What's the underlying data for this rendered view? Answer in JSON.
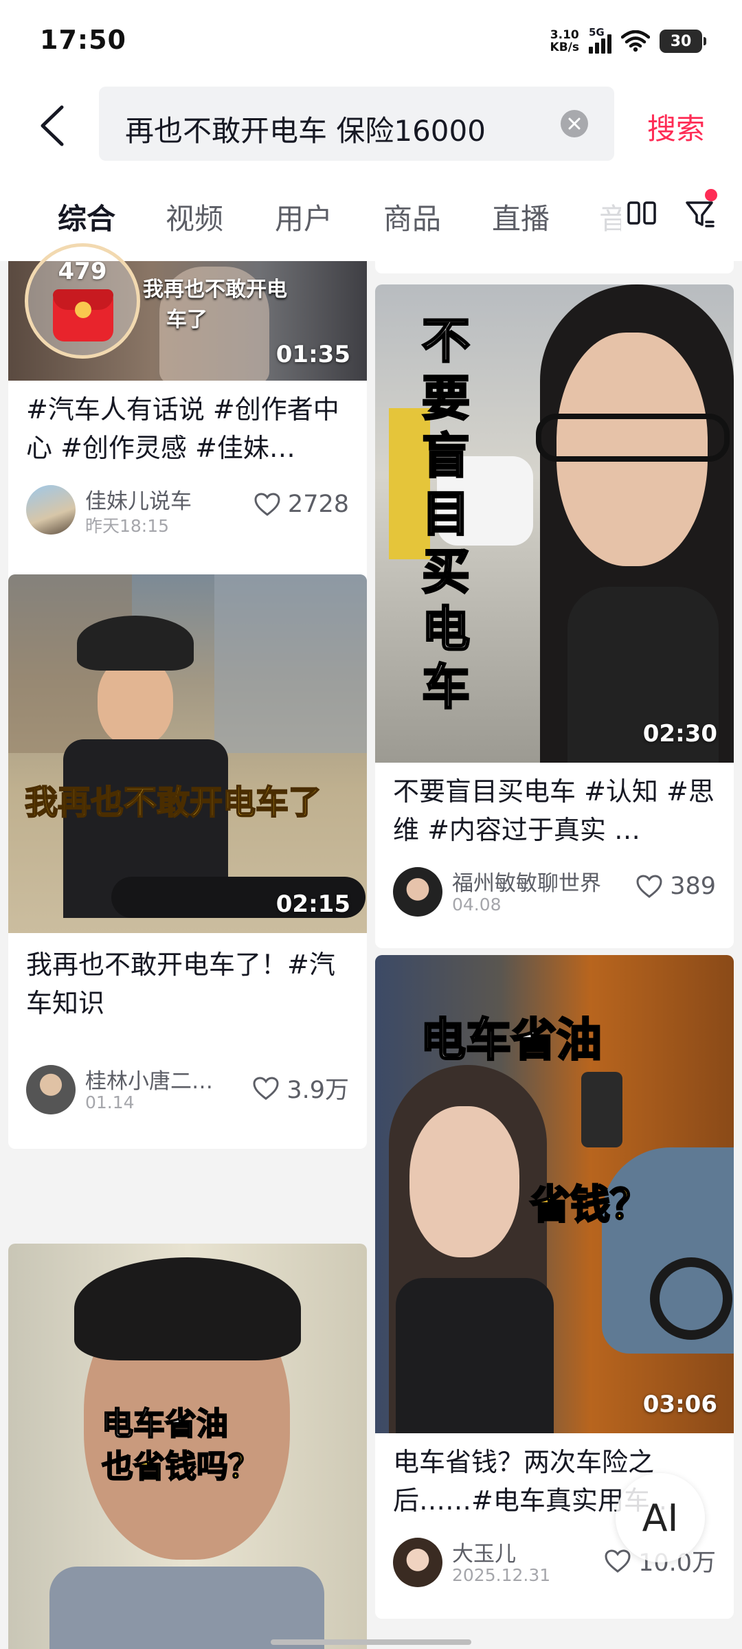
{
  "status_bar": {
    "time": "17:50",
    "net_speed_value": "3.10",
    "net_speed_unit": "KB/s",
    "network_type": "5G",
    "battery": "30"
  },
  "search": {
    "query": "再也不敢开电车 保险16000",
    "button_label": "搜索"
  },
  "tabs": [
    "综合",
    "视频",
    "用户",
    "商品",
    "直播",
    "音"
  ],
  "active_tab": "综合",
  "red_packet": {
    "count": "479"
  },
  "left_column": [
    {
      "overlay_line1": "我再也不敢开电",
      "overlay_line2": "车了",
      "duration": "01:35",
      "title": "#汽车人有话说 #创作者中心 #创作灵感 #佳妹…",
      "author": "佳妹儿说车",
      "date": "昨天18:15",
      "likes": "2728"
    },
    {
      "overlay": "我再也不敢开电车了",
      "duration": "02:15",
      "title": "我再也不敢开电车了！#汽车知识",
      "author": "桂林小唐二…",
      "date": "01.14",
      "likes": "3.9万"
    },
    {
      "overlay_line1": "电车省油",
      "overlay_line2": "也省钱吗？"
    }
  ],
  "right_column": [
    {
      "overlay": "不要盲目买电车",
      "duration": "02:30",
      "title": "不要盲目买电车 #认知 #思维 #内容过于真实 …",
      "author": "福州敏敏聊世界",
      "date": "04.08",
      "likes": "389"
    },
    {
      "overlay_line1": "电车省油",
      "overlay_line2": "省钱？",
      "duration": "03:06",
      "title": "电车省钱？两次车险之后……#电车真实用车…",
      "author": "大玉儿",
      "date": "2025.12.31",
      "likes": "10.0万"
    }
  ],
  "ai_button": {
    "label": "AI"
  },
  "colors": {
    "accent": "#fe2c55",
    "background": "#f3f3f3"
  }
}
